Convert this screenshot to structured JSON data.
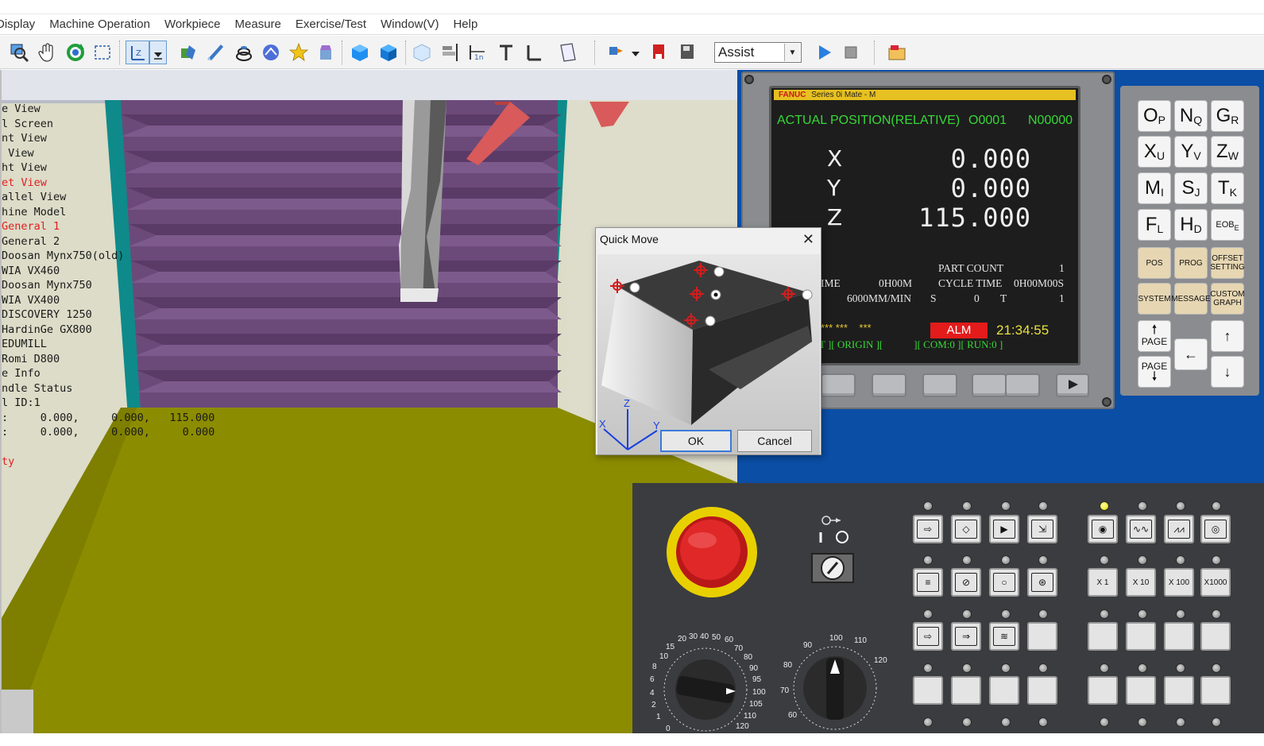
{
  "menu": [
    "Display",
    "Machine Operation",
    "Workpiece",
    "Measure",
    "Exercise/Test",
    "Window(V)",
    "Help"
  ],
  "toolbar": {
    "mode_select": "Assist"
  },
  "viewport": {
    "info_lines": [
      "e View",
      "l Screen",
      "nt View",
      " View",
      "ht View",
      "et View",
      "allel View",
      "hine Model",
      "General 1",
      "General 2",
      "Doosan Mynx750(old)",
      "WIA VX460",
      "Doosan Mynx750",
      "WIA VX400",
      "DISCOVERY 1250",
      "HardinGe GX800",
      "EDUMILL",
      "Romi D800",
      "e Info",
      "ndle Status",
      "l ID:1",
      ":     0.000,     0.000,   115.000",
      ":     0.000,     0.000,     0.000",
      "",
      "ty"
    ],
    "red_lines": [
      5,
      8,
      24
    ]
  },
  "cnc": {
    "brand": "FANUC",
    "series": "Series 0i Mate - M",
    "screen_title": "ACTUAL POSITION(RELATIVE)",
    "program_no": "O0001",
    "sequence_no": "N00000",
    "axes": [
      {
        "label": "X",
        "value": "0.000"
      },
      {
        "label": "Y",
        "value": "0.000"
      },
      {
        "label": "Z",
        "value": "115.000"
      }
    ],
    "part_count_label": "PART COUNT",
    "part_count": "1",
    "run_time_label": "IME",
    "run_time": "0H00M",
    "cycle_time_label": "CYCLE TIME",
    "cycle_time": "0H00M00S",
    "feed": "6000MM/MIN",
    "s_label": "S",
    "s_value": "0",
    "t_label": "T",
    "t_value": "1",
    "status_left": "*** ***    ***",
    "alarm": "ALM",
    "clock": "21:34:55",
    "softkey_row": "T ][ ORIGIN ][            ][ COM:0 ][ RUN:0 ]"
  },
  "keypad": {
    "keys": [
      {
        "m": "O",
        "s": "P"
      },
      {
        "m": "N",
        "s": "Q"
      },
      {
        "m": "G",
        "s": "R"
      },
      {
        "m": "X",
        "s": "U"
      },
      {
        "m": "Y",
        "s": "V"
      },
      {
        "m": "Z",
        "s": "W"
      },
      {
        "m": "M",
        "s": "I"
      },
      {
        "m": "S",
        "s": "J"
      },
      {
        "m": "T",
        "s": "K"
      },
      {
        "m": "F",
        "s": "L"
      },
      {
        "m": "H",
        "s": "D"
      },
      {
        "m": "EOB",
        "s": "E"
      }
    ],
    "func_keys": [
      "POS",
      "PROG",
      "OFFSET SETTING",
      "SYSTEM",
      "MESSAGE",
      "CUSTOM GRAPH"
    ],
    "page_label": "PAGE"
  },
  "operator_panel": {
    "feed_override_ticks": [
      "0",
      "1",
      "2",
      "4",
      "6",
      "8",
      "10",
      "15",
      "20",
      "30",
      "40",
      "50",
      "60",
      "70",
      "80",
      "90",
      "95",
      "100",
      "105",
      "110",
      "120"
    ],
    "spindle_override_ticks": [
      "60",
      "70",
      "80",
      "90",
      "100",
      "110",
      "120"
    ],
    "step_buttons": [
      "X  1",
      "X  10",
      "X  100",
      "X1000"
    ]
  },
  "dialog": {
    "title": "Quick Move",
    "ok": "OK",
    "cancel": "Cancel",
    "axes": [
      "X",
      "Y",
      "Z"
    ]
  }
}
